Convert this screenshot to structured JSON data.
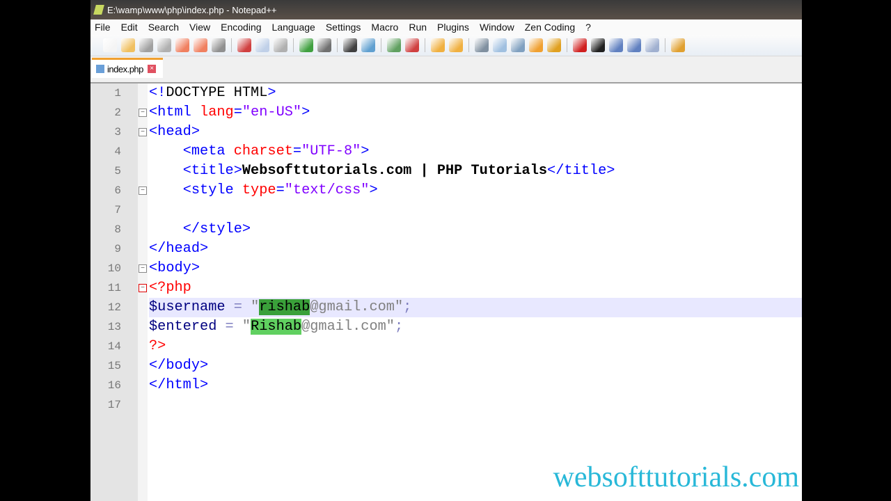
{
  "window": {
    "title": "E:\\wamp\\www\\php\\index.php - Notepad++"
  },
  "menu": [
    "File",
    "Edit",
    "Search",
    "View",
    "Encoding",
    "Language",
    "Settings",
    "Macro",
    "Run",
    "Plugins",
    "Window",
    "Zen Coding",
    "?"
  ],
  "tab": {
    "label": "index.php"
  },
  "code": [
    [
      [
        "tag",
        "<!"
      ],
      [
        "dt",
        "DOCTYPE HTML"
      ],
      [
        "tag",
        ">"
      ]
    ],
    [
      [
        "tag",
        "<html "
      ],
      [
        "attr",
        "lang"
      ],
      [
        "tag",
        "="
      ],
      [
        "str",
        "\"en-US\""
      ],
      [
        "tag",
        ">"
      ]
    ],
    [
      [
        "tag",
        "<head>"
      ]
    ],
    [
      [
        "dt",
        "    "
      ],
      [
        "tag",
        "<meta "
      ],
      [
        "attr",
        "charset"
      ],
      [
        "tag",
        "="
      ],
      [
        "str",
        "\"UTF-8\""
      ],
      [
        "tag",
        ">"
      ]
    ],
    [
      [
        "dt",
        "    "
      ],
      [
        "tag",
        "<title>"
      ],
      [
        "txt",
        "Websofttutorials.com | PHP Tutorials"
      ],
      [
        "tag",
        "</title>"
      ]
    ],
    [
      [
        "dt",
        "    "
      ],
      [
        "tag",
        "<style "
      ],
      [
        "attr",
        "type"
      ],
      [
        "tag",
        "="
      ],
      [
        "str",
        "\"text/css\""
      ],
      [
        "tag",
        ">"
      ]
    ],
    [],
    [
      [
        "dt",
        "    "
      ],
      [
        "tag",
        "</style>"
      ]
    ],
    [
      [
        "tag",
        "</head>"
      ]
    ],
    [
      [
        "tag",
        "<body>"
      ]
    ],
    [
      [
        "php",
        "<?php"
      ]
    ],
    [
      [
        "var",
        "$username"
      ],
      [
        "op",
        " = "
      ],
      [
        "pstr",
        "\""
      ],
      [
        "hl2",
        "rishab"
      ],
      [
        "pstr",
        "@gmail.com\""
      ],
      [
        "op",
        ";"
      ]
    ],
    [
      [
        "var",
        "$entered"
      ],
      [
        "op",
        " = "
      ],
      [
        "pstr",
        "\""
      ],
      [
        "hl",
        "Rishab"
      ],
      [
        "pstr",
        "@gmail.com\""
      ],
      [
        "op",
        ";"
      ]
    ],
    [
      [
        "php",
        "?>"
      ]
    ],
    [
      [
        "tag",
        "</body>"
      ]
    ],
    [
      [
        "tag",
        "</html>"
      ]
    ],
    []
  ],
  "watermark": "websofttutorials.com"
}
